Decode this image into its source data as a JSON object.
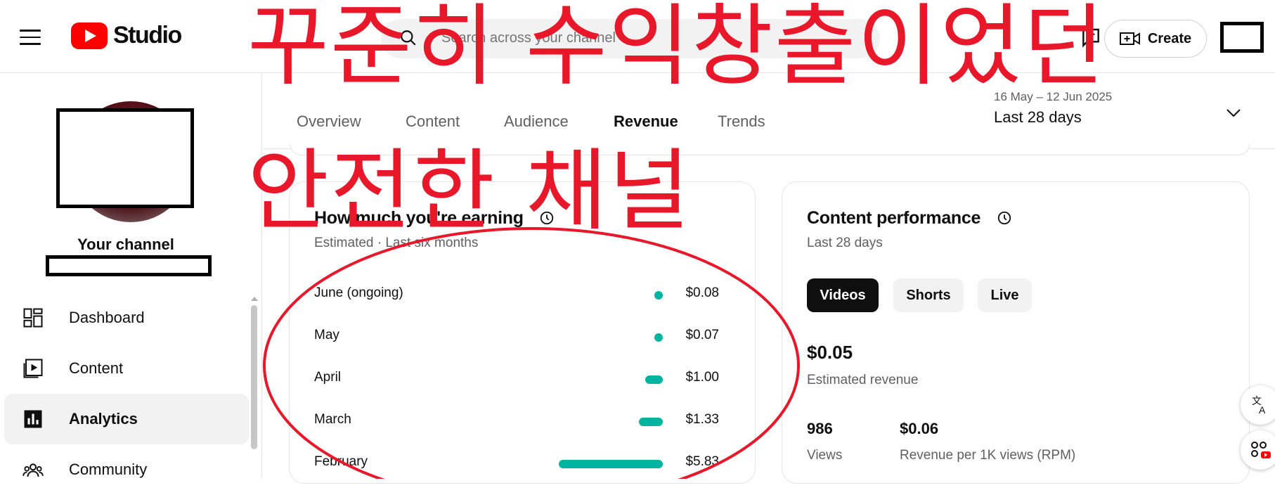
{
  "header": {
    "logo_text": "Studio",
    "search_placeholder": "Search across your channel",
    "create_label": "Create"
  },
  "sidebar": {
    "channel_title": "Your channel",
    "items": [
      {
        "label": "Dashboard",
        "icon": "dashboard-icon"
      },
      {
        "label": "Content",
        "icon": "content-icon"
      },
      {
        "label": "Analytics",
        "icon": "analytics-icon",
        "active": true
      },
      {
        "label": "Community",
        "icon": "community-icon"
      }
    ]
  },
  "tabs": {
    "items": [
      "Overview",
      "Content",
      "Audience",
      "Revenue",
      "Trends"
    ],
    "active": "Revenue",
    "date_range": "16 May – 12 Jun 2025",
    "date_label": "Last 28 days"
  },
  "earning": {
    "title": "How much you're earning",
    "subtitle": "Estimated · Last six months",
    "rows": [
      {
        "month": "June (ongoing)",
        "value": "$0.08",
        "amount": 0.08
      },
      {
        "month": "May",
        "value": "$0.07",
        "amount": 0.07
      },
      {
        "month": "April",
        "value": "$1.00",
        "amount": 1.0
      },
      {
        "month": "March",
        "value": "$1.33",
        "amount": 1.33
      },
      {
        "month": "February",
        "value": "$5.83",
        "amount": 5.83
      }
    ]
  },
  "performance": {
    "title": "Content performance",
    "subtitle": "Last 28 days",
    "pills": [
      "Videos",
      "Shorts",
      "Live"
    ],
    "active_pill": "Videos",
    "revenue_value": "$0.05",
    "revenue_label": "Estimated revenue",
    "views_value": "986",
    "views_label": "Views",
    "rpm_value": "$0.06",
    "rpm_label": "Revenue per 1K views (RPM)"
  },
  "overlay": {
    "line1": "꾸준히 수익창출이었던",
    "line2": "안전한 채널",
    "color": "#e8172a"
  },
  "colors": {
    "accent_teal": "#00b4a0",
    "youtube_red": "#ff0000"
  }
}
